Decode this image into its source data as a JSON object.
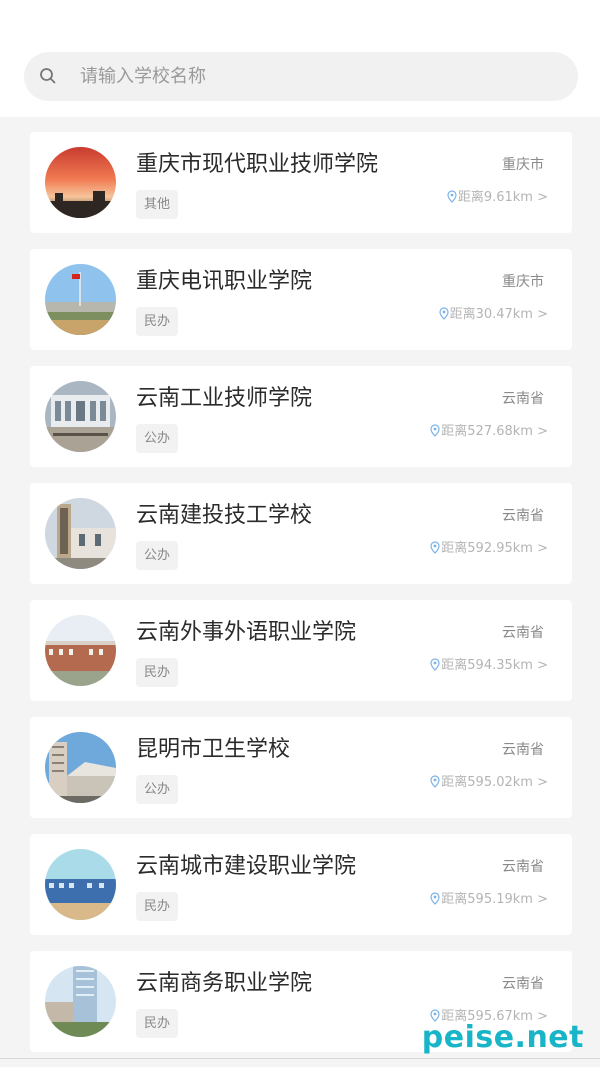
{
  "search": {
    "placeholder": "请输入学校名称"
  },
  "schools": [
    {
      "name": "重庆市现代职业技师学院",
      "tag": "其他",
      "region": "重庆市",
      "distance": "距离9.61km >",
      "thumb": "sunset"
    },
    {
      "name": "重庆电讯职业学院",
      "tag": "民办",
      "region": "重庆市",
      "distance": "距离30.47km >",
      "thumb": "flag"
    },
    {
      "name": "云南工业技师学院",
      "tag": "公办",
      "region": "云南省",
      "distance": "距离527.68km >",
      "thumb": "building-gray"
    },
    {
      "name": "云南建投技工学校",
      "tag": "公办",
      "region": "云南省",
      "distance": "距离592.95km >",
      "thumb": "gate"
    },
    {
      "name": "云南外事外语职业学院",
      "tag": "民办",
      "region": "云南省",
      "distance": "距离594.35km >",
      "thumb": "campus-red"
    },
    {
      "name": "昆明市卫生学校",
      "tag": "公办",
      "region": "云南省",
      "distance": "距离595.02km >",
      "thumb": "tower"
    },
    {
      "name": "云南城市建设职业学院",
      "tag": "民办",
      "region": "云南省",
      "distance": "距离595.19km >",
      "thumb": "campus-blue"
    },
    {
      "name": "云南商务职业学院",
      "tag": "民办",
      "region": "云南省",
      "distance": "距离595.67km >",
      "thumb": "highrise"
    }
  ],
  "watermark": "peise.net"
}
